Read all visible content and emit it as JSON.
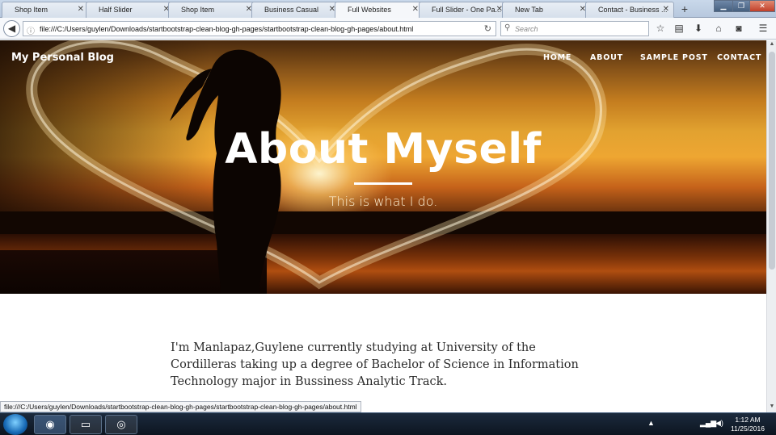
{
  "browser": {
    "tabs": [
      {
        "label": "Shop Item",
        "active": false
      },
      {
        "label": "Half Slider",
        "active": false
      },
      {
        "label": "Shop Item",
        "active": false
      },
      {
        "label": "Business Casual",
        "active": false
      },
      {
        "label": "Full Websites",
        "active": true
      },
      {
        "label": "Full Slider - One Pa...",
        "active": false
      },
      {
        "label": "New Tab",
        "active": false
      },
      {
        "label": "Contact - Business ...",
        "active": false
      }
    ],
    "new_tab_label": "+",
    "url": "file:///C:/Users/guylen/Downloads/startbootstrap-clean-blog-gh-pages/startbootstrap-clean-blog-gh-pages/about.html",
    "search_placeholder": "Search",
    "status_url": "file:///C:/Users/guylen/Downloads/startbootstrap-clean-blog-gh-pages/startbootstrap-clean-blog-gh-pages/about.html"
  },
  "site": {
    "brand": "My Personal Blog",
    "nav": [
      "HOME",
      "ABOUT",
      "SAMPLE POST",
      "CONTACT"
    ],
    "hero_title": "About Myself",
    "hero_subtitle": "This is what I do.",
    "paragraph": "I'm Manlapaz,Guylene currently studying at University of the Cordilleras taking up a degree of Bachelor of Science in Information Technology major in Bussiness Analytic Track."
  },
  "taskbar": {
    "time": "1:12 AM",
    "date": "11/25/2016"
  },
  "icons": [
    "back-icon",
    "info-icon",
    "reload-icon",
    "search-icon",
    "bookmark-star-icon",
    "reading-list-icon",
    "download-icon",
    "home-icon",
    "pocket-icon",
    "menu-icon",
    "windows-start-icon",
    "firefox-icon",
    "file-explorer-icon",
    "chrome-icon"
  ],
  "colors": {
    "hero_accent": "#eea632",
    "text": "#2b2b2b"
  }
}
